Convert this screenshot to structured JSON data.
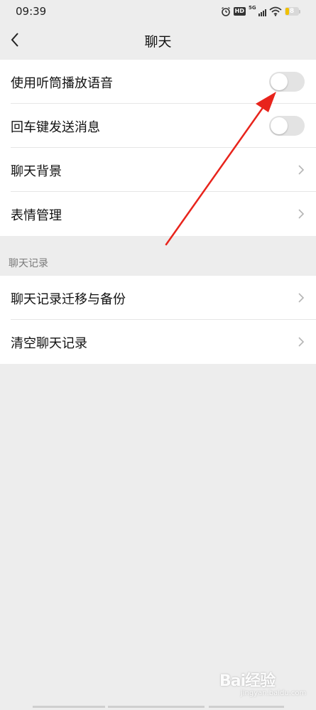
{
  "status_bar": {
    "time": "09:39",
    "network": "5G",
    "hd": "HD",
    "battery": "8"
  },
  "header": {
    "title": "聊天"
  },
  "settings": {
    "items": [
      {
        "label": "使用听筒播放语音",
        "control": "toggle",
        "on": false
      },
      {
        "label": "回车键发送消息",
        "control": "toggle",
        "on": false
      },
      {
        "label": "聊天背景",
        "control": "chevron"
      },
      {
        "label": "表情管理",
        "control": "chevron"
      }
    ]
  },
  "chat_history": {
    "section_title": "聊天记录",
    "items": [
      {
        "label": "聊天记录迁移与备份",
        "control": "chevron"
      },
      {
        "label": "清空聊天记录",
        "control": "chevron"
      }
    ]
  },
  "annotation": {
    "arrow_color": "#e8241c"
  },
  "watermark": {
    "text": "Bai经验",
    "sub": "jingyan.baidu.com"
  },
  "colors": {
    "background": "#ededed",
    "toggle_off": "#e3e3e3",
    "section_text": "#7a7a7a"
  }
}
